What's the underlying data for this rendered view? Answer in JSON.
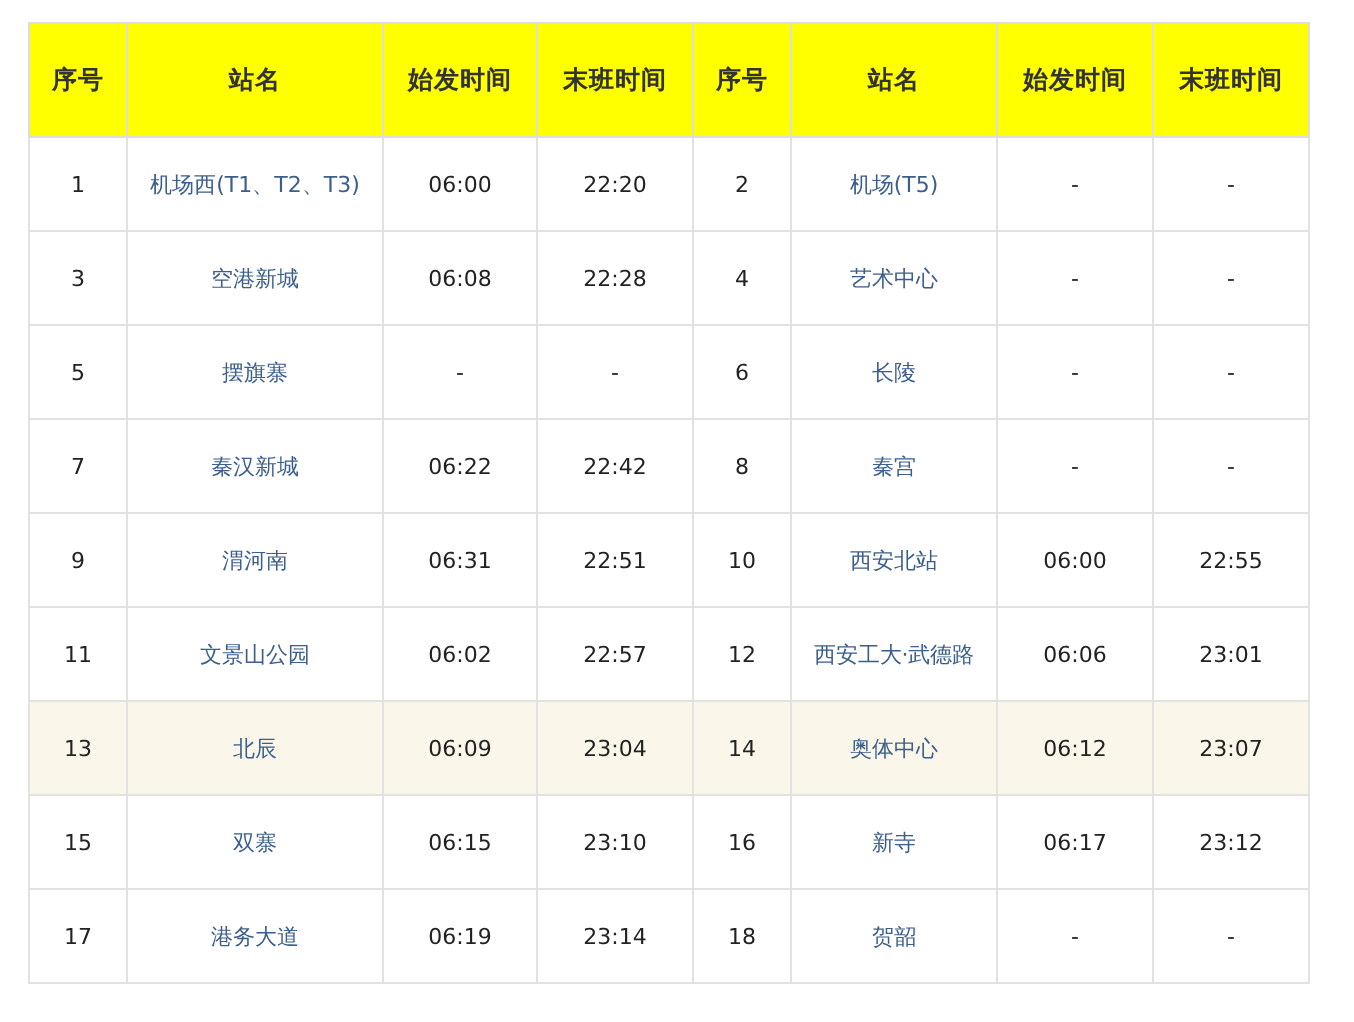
{
  "table": {
    "columns": [
      "序号",
      "站名",
      "始发时间",
      "末班时间",
      "序号",
      "站名",
      "始发时间",
      "末班时间"
    ],
    "rows": [
      {
        "highlighted": false,
        "stations": [
          {
            "number": "1",
            "name": "机场西(T1、T2、T3)",
            "first": "06:00",
            "last": "22:20"
          },
          {
            "number": "2",
            "name": "机场(T5)",
            "first": "-",
            "last": "-"
          }
        ]
      },
      {
        "highlighted": false,
        "stations": [
          {
            "number": "3",
            "name": "空港新城",
            "first": "06:08",
            "last": "22:28"
          },
          {
            "number": "4",
            "name": "艺术中心",
            "first": "-",
            "last": "-"
          }
        ]
      },
      {
        "highlighted": false,
        "stations": [
          {
            "number": "5",
            "name": "摆旗寨",
            "first": "-",
            "last": "-"
          },
          {
            "number": "6",
            "name": "长陵",
            "first": "-",
            "last": "-"
          }
        ]
      },
      {
        "highlighted": false,
        "stations": [
          {
            "number": "7",
            "name": "秦汉新城",
            "first": "06:22",
            "last": "22:42"
          },
          {
            "number": "8",
            "name": "秦宫",
            "first": "-",
            "last": "-"
          }
        ]
      },
      {
        "highlighted": false,
        "stations": [
          {
            "number": "9",
            "name": "渭河南",
            "first": "06:31",
            "last": "22:51"
          },
          {
            "number": "10",
            "name": "西安北站",
            "first": "06:00",
            "last": "22:55"
          }
        ]
      },
      {
        "highlighted": false,
        "stations": [
          {
            "number": "11",
            "name": "文景山公园",
            "first": "06:02",
            "last": "22:57"
          },
          {
            "number": "12",
            "name": "西安工大·武德路",
            "first": "06:06",
            "last": "23:01"
          }
        ]
      },
      {
        "highlighted": true,
        "stations": [
          {
            "number": "13",
            "name": "北辰",
            "first": "06:09",
            "last": "23:04"
          },
          {
            "number": "14",
            "name": "奥体中心",
            "first": "06:12",
            "last": "23:07"
          }
        ]
      },
      {
        "highlighted": false,
        "stations": [
          {
            "number": "15",
            "name": "双寨",
            "first": "06:15",
            "last": "23:10"
          },
          {
            "number": "16",
            "name": "新寺",
            "first": "06:17",
            "last": "23:12"
          }
        ]
      },
      {
        "highlighted": false,
        "stations": [
          {
            "number": "17",
            "name": "港务大道",
            "first": "06:19",
            "last": "23:14"
          },
          {
            "number": "18",
            "name": "贺韶",
            "first": "-",
            "last": "-"
          }
        ]
      }
    ]
  }
}
